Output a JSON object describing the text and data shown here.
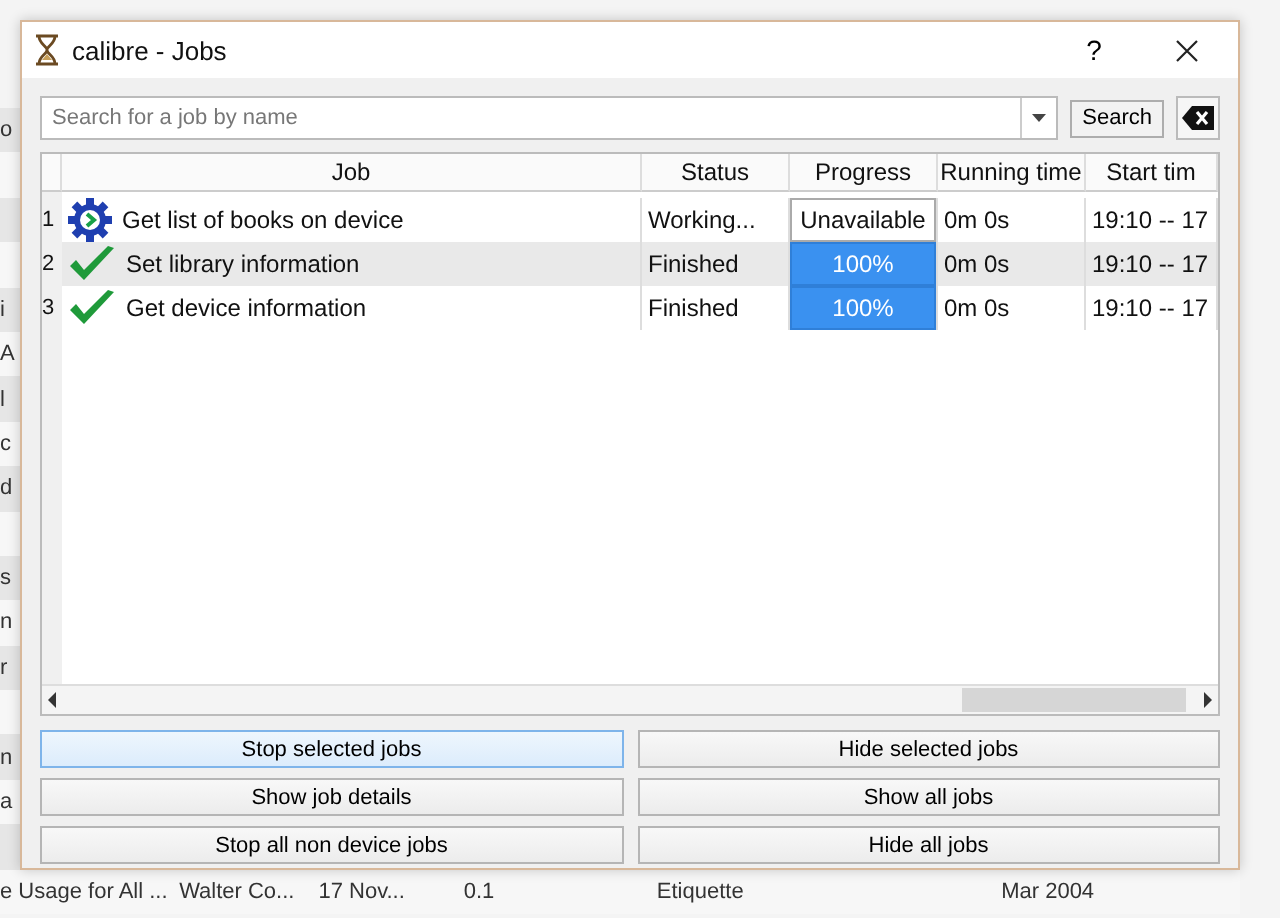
{
  "background_rows": [
    {
      "cells": [
        "o"
      ]
    },
    {},
    {},
    {},
    {
      "cells": [
        "i"
      ]
    },
    {
      "cells": [
        "A"
      ]
    },
    {
      "cells": [
        "l"
      ]
    },
    {
      "cells": [
        "c"
      ]
    },
    {
      "cells": [
        "d"
      ]
    },
    {},
    {
      "cells": [
        "s"
      ]
    },
    {
      "cells": [
        "n"
      ]
    },
    {
      "cells": [
        "r"
      ]
    },
    {},
    {
      "cells": [
        "n"
      ]
    },
    {
      "cells": [
        "a"
      ]
    },
    {},
    {
      "cells": [
        "e Usage for All ...",
        "Walter Co...",
        "17 Nov...",
        "0.1",
        "Etiquette",
        "Mar 2004"
      ]
    }
  ],
  "window": {
    "title": "calibre - Jobs",
    "help": "?"
  },
  "search": {
    "placeholder": "Search for a job by name",
    "button": "Search"
  },
  "table": {
    "columns": [
      "Job",
      "Status",
      "Progress",
      "Running time",
      "Start tim"
    ],
    "rows": [
      {
        "number": "1",
        "kind": "working",
        "job": "Get list of books on device",
        "status": "Working...",
        "progress": "Unavailable",
        "running_time": "0m 0s",
        "start_time": "19:10 -- 17"
      },
      {
        "number": "2",
        "kind": "finished",
        "job": "Set library information",
        "status": "Finished",
        "progress": "100%",
        "level": 1,
        "running_time": "0m 0s",
        "start_time": "19:10 -- 17"
      },
      {
        "number": "3",
        "kind": "finished",
        "job": "Get device information",
        "status": "Finished",
        "progress": "100%",
        "level": 1,
        "running_time": "0m 0s",
        "start_time": "19:10 -- 17"
      }
    ]
  },
  "buttons": [
    {
      "label": "Stop selected jobs",
      "focused": true
    },
    {
      "label": "Hide selected jobs",
      "focused": false
    },
    {
      "label": "Show job details",
      "focused": false
    },
    {
      "label": "Show all jobs",
      "focused": false
    },
    {
      "label": "Stop all non device jobs",
      "focused": false
    },
    {
      "label": "Hide all jobs",
      "focused": false
    }
  ]
}
